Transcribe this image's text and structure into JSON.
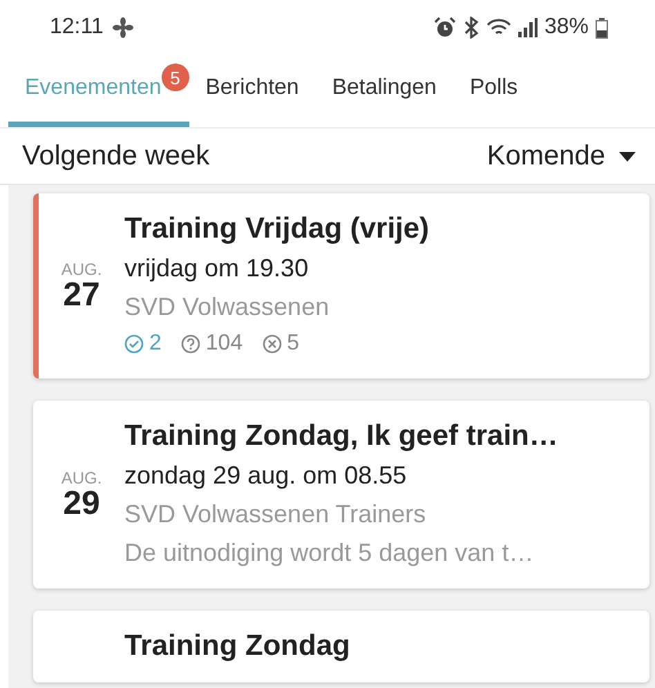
{
  "status_bar": {
    "time": "12:11",
    "battery": "38%"
  },
  "tabs": [
    {
      "label": "Evenementen",
      "selected": true,
      "badge": "5"
    },
    {
      "label": "Berichten",
      "selected": false
    },
    {
      "label": "Betalingen",
      "selected": false
    },
    {
      "label": "Polls",
      "selected": false
    }
  ],
  "filter": {
    "period": "Volgende week",
    "dropdown": "Komende"
  },
  "events": [
    {
      "month": "AUG.",
      "day": "27",
      "title": "Training Vrijdag (vrije)",
      "when": "vrijdag om 19.30",
      "group": "SVD Volwassenen",
      "highlighted": true,
      "responses": {
        "accepted": "2",
        "unknown": "104",
        "declined": "5"
      }
    },
    {
      "month": "AUG.",
      "day": "29",
      "title": "Training Zondag, Ik geef train…",
      "when": "zondag 29 aug. om 08.55",
      "group": "SVD Volwassenen Trainers",
      "note": "De uitnodiging wordt 5 dagen van t…",
      "highlighted": false
    },
    {
      "title": "Training Zondag",
      "highlighted": false
    }
  ]
}
